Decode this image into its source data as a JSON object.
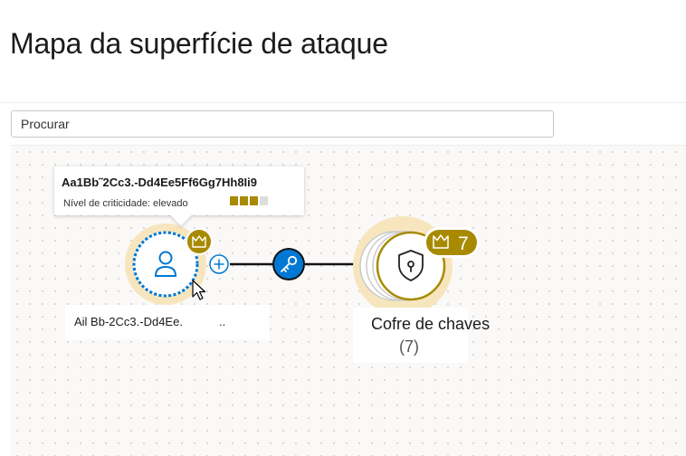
{
  "page": {
    "title": "Mapa da superfície de ataque"
  },
  "search": {
    "placeholder": "Procurar",
    "value": ""
  },
  "tooltip": {
    "title": "Aa1Bb˜2Cc3.-Dd4Ee5Ff6Gg7Hh8Ii9",
    "criticality_label": "Nível de criticidade: elevado",
    "criticality_bars_filled": 3,
    "criticality_bars_total": 4
  },
  "user_node": {
    "label": "Ail Bb-2Cc3.-Dd4Ee.",
    "label_suffix": "..",
    "icon": "user-icon",
    "badge_icon": "crown-icon",
    "expand_icon": "plus-icon"
  },
  "edge": {
    "icon": "key-icon"
  },
  "keyvault_node": {
    "label": "Cofre de chaves",
    "count_text": "(7)",
    "badge_icon": "crown-icon",
    "badge_count": "7",
    "icon": "shield-lock-icon"
  },
  "colors": {
    "accent_blue": "#0078d4",
    "gold": "#a88a00",
    "gold_halo": "#f5e2b5",
    "edge_line": "#111111"
  }
}
